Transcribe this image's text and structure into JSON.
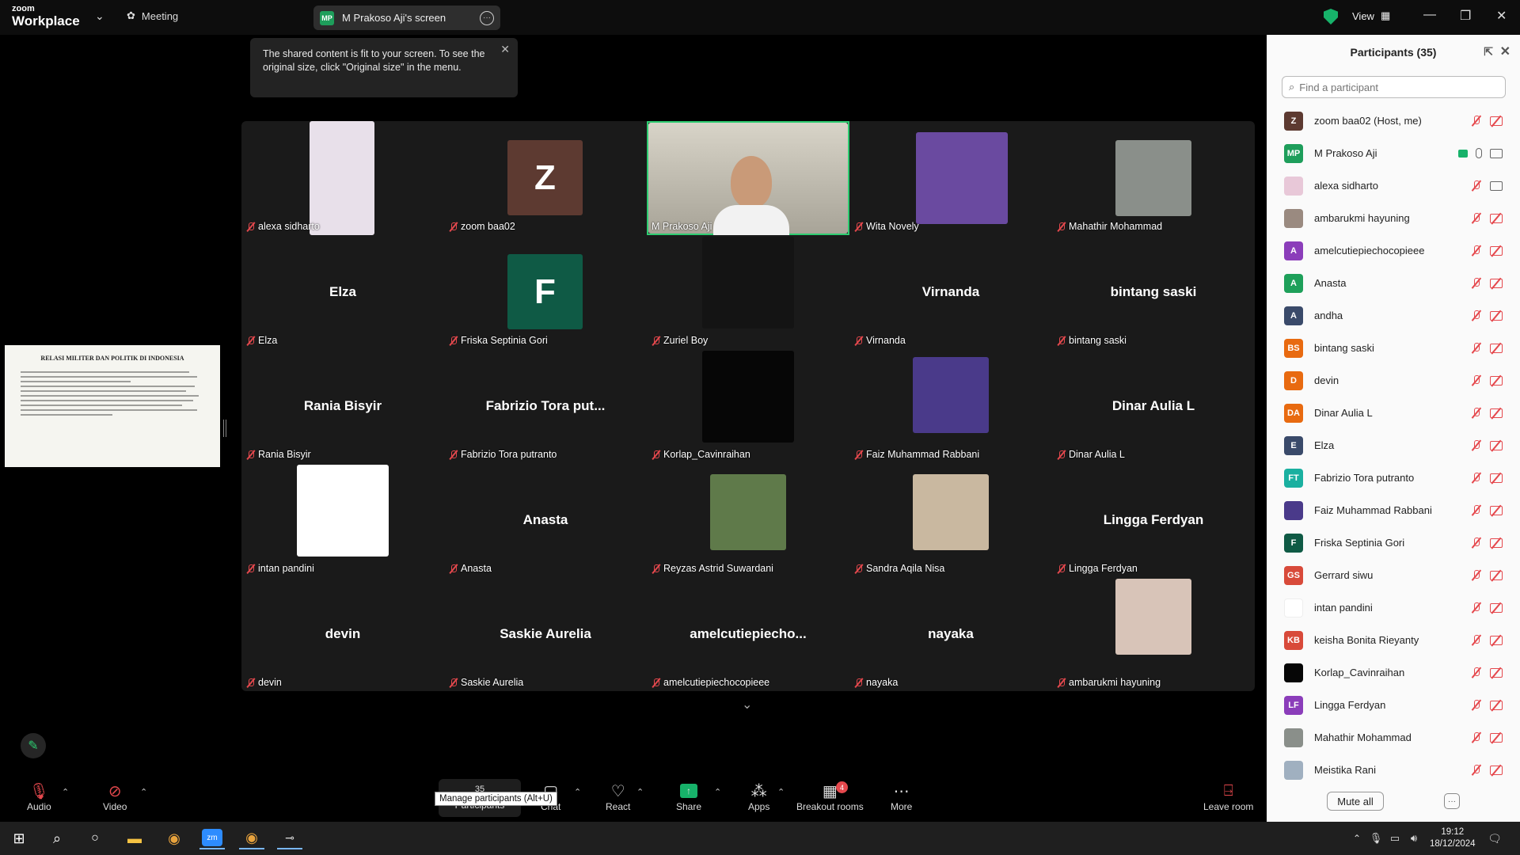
{
  "titlebar": {
    "logo_top": "zoom",
    "logo_bottom": "Workplace",
    "meeting_label": "Meeting",
    "screen_badge": "MP",
    "screen_label": "M Prakoso Aji's screen",
    "view_label": "View"
  },
  "toast": {
    "text": "The shared content is fit to your screen. To see the original size, click \"Original size\" in the menu."
  },
  "slide": {
    "title": "RELASI MILITER DAN POLITIK DI INDONESIA"
  },
  "tiles": [
    {
      "name": "alexa sidharto",
      "big": "",
      "type": "pic",
      "color": "#e8e0ea"
    },
    {
      "name": "zoom baa02",
      "big": "Z",
      "type": "letter",
      "color": "#5d3a31"
    },
    {
      "name": "M Prakoso Aji",
      "big": "",
      "type": "video",
      "color": "#b8b4a8"
    },
    {
      "name": "Wita Novely",
      "big": "",
      "type": "pic",
      "color": "#6a4aa0"
    },
    {
      "name": "Mahathir Mohammad",
      "big": "",
      "type": "pic",
      "color": "#8a8f8a"
    },
    {
      "name": "Elza",
      "big": "Elza",
      "type": "text",
      "color": ""
    },
    {
      "name": "Friska Septinia Gori",
      "big": "F",
      "type": "letter",
      "color": "#0f5a45"
    },
    {
      "name": "Zuriel Boy",
      "big": "",
      "type": "pic",
      "color": "#141414"
    },
    {
      "name": "Virnanda",
      "big": "Virnanda",
      "type": "text",
      "color": ""
    },
    {
      "name": "bintang saski",
      "big": "bintang saski",
      "type": "text",
      "color": ""
    },
    {
      "name": "Rania Bisyir",
      "big": "Rania Bisyir",
      "type": "text",
      "color": ""
    },
    {
      "name": "Fabrizio Tora putranto",
      "big": "Fabrizio Tora put...",
      "type": "text",
      "color": ""
    },
    {
      "name": "Korlap_Cavinraihan",
      "big": "",
      "type": "pic",
      "color": "#060606"
    },
    {
      "name": "Faiz Muhammad Rabbani",
      "big": "",
      "type": "pic",
      "color": "#4a3a8a"
    },
    {
      "name": "Dinar Aulia L",
      "big": "Dinar Aulia L",
      "type": "text",
      "color": ""
    },
    {
      "name": "intan pandini",
      "big": "",
      "type": "pic",
      "color": "#ffffff"
    },
    {
      "name": "Anasta",
      "big": "Anasta",
      "type": "text",
      "color": ""
    },
    {
      "name": "Reyzas Astrid Suwardani",
      "big": "",
      "type": "pic",
      "color": "#5f7a4a"
    },
    {
      "name": "Sandra Aqila Nisa",
      "big": "",
      "type": "pic",
      "color": "#c9b8a0"
    },
    {
      "name": "Lingga Ferdyan",
      "big": "Lingga Ferdyan",
      "type": "text",
      "color": ""
    },
    {
      "name": "devin",
      "big": "devin",
      "type": "text",
      "color": ""
    },
    {
      "name": "Saskie Aurelia",
      "big": "Saskie Aurelia",
      "type": "text",
      "color": ""
    },
    {
      "name": "amelcutiepiechocopieee",
      "big": "amelcutiepiecho...",
      "type": "text",
      "color": ""
    },
    {
      "name": "nayaka",
      "big": "nayaka",
      "type": "text",
      "color": ""
    },
    {
      "name": "ambarukmi hayuning",
      "big": "",
      "type": "pic",
      "color": "#d8c4b8"
    }
  ],
  "panel": {
    "title": "Participants (35)",
    "search_placeholder": "Find a participant",
    "mute_all": "Mute all"
  },
  "participants": [
    {
      "name": "zoom baa02 (Host, me)",
      "initials": "Z",
      "color": "#5d3a31",
      "state": "off"
    },
    {
      "name": "M Prakoso Aji",
      "initials": "MP",
      "color": "#1e9e5b",
      "state": "on"
    },
    {
      "name": "alexa sidharto",
      "initials": "",
      "color": "#e8c8d8",
      "state": "camon"
    },
    {
      "name": "ambarukmi hayuning",
      "initials": "",
      "color": "#9a8a80",
      "state": "off"
    },
    {
      "name": "amelcutiepiechocopieee",
      "initials": "A",
      "color": "#8b3dba",
      "state": "off"
    },
    {
      "name": "Anasta",
      "initials": "A",
      "color": "#1ea05a",
      "state": "off"
    },
    {
      "name": "andha",
      "initials": "A",
      "color": "#3a4a6a",
      "state": "off"
    },
    {
      "name": "bintang saski",
      "initials": "BS",
      "color": "#e86a10",
      "state": "off"
    },
    {
      "name": "devin",
      "initials": "D",
      "color": "#e86a10",
      "state": "off"
    },
    {
      "name": "Dinar Aulia L",
      "initials": "DA",
      "color": "#e86a10",
      "state": "off"
    },
    {
      "name": "Elza",
      "initials": "E",
      "color": "#3a4a6a",
      "state": "off"
    },
    {
      "name": "Fabrizio Tora putranto",
      "initials": "FT",
      "color": "#1ab0a0",
      "state": "off"
    },
    {
      "name": "Faiz Muhammad Rabbani",
      "initials": "",
      "color": "#4a3a8a",
      "state": "off"
    },
    {
      "name": "Friska Septinia Gori",
      "initials": "F",
      "color": "#0f5a45",
      "state": "off"
    },
    {
      "name": "Gerrard siwu",
      "initials": "GS",
      "color": "#d84a3a",
      "state": "off"
    },
    {
      "name": "intan pandini",
      "initials": "",
      "color": "#ffffff",
      "state": "off"
    },
    {
      "name": "keisha Bonita Rieyanty",
      "initials": "KB",
      "color": "#d84a3a",
      "state": "off"
    },
    {
      "name": "Korlap_Cavinraihan",
      "initials": "",
      "color": "#060606",
      "state": "off"
    },
    {
      "name": "Lingga Ferdyan",
      "initials": "LF",
      "color": "#8b3dba",
      "state": "off"
    },
    {
      "name": "Mahathir Mohammad",
      "initials": "",
      "color": "#8a8f8a",
      "state": "off"
    },
    {
      "name": "Meistika Rani",
      "initials": "",
      "color": "#a0b0c0",
      "state": "off"
    }
  ],
  "toolbar": {
    "audio": "Audio",
    "video": "Video",
    "participants": "Participants",
    "participants_count": "35",
    "chat": "Chat",
    "react": "React",
    "share": "Share",
    "apps": "Apps",
    "breakout": "Breakout rooms",
    "breakout_badge": "4",
    "more": "More",
    "leave": "Leave room",
    "tooltip": "Manage participants (Alt+U)"
  },
  "taskbar": {
    "time": "19:12",
    "date": "18/12/2024"
  },
  "colors": {
    "accent_green": "#2ecc71",
    "muted_red": "#e5484d",
    "grid_bg": "#1a1a1a"
  }
}
